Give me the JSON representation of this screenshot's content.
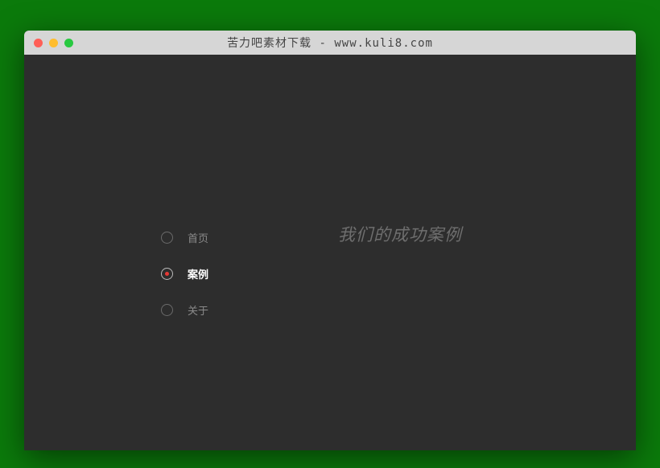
{
  "window": {
    "title": "苦力吧素材下载 - www.kuli8.com"
  },
  "nav": {
    "items": [
      {
        "label": "首页",
        "active": false
      },
      {
        "label": "案例",
        "active": true
      },
      {
        "label": "关于",
        "active": false
      }
    ]
  },
  "main": {
    "heading": "我们的成功案例"
  }
}
